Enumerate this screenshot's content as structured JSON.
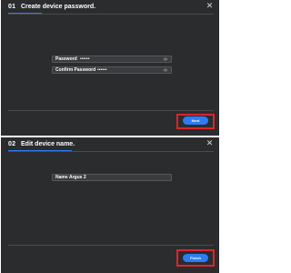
{
  "colors": {
    "dialog_bg": "#2b2c2e",
    "accent": "#2d7cf6",
    "highlight": "#e0242b"
  },
  "dialog1": {
    "step": "01",
    "title": "Create device password.",
    "password_label": "Password",
    "password_value": "••••••",
    "confirm_label": "Confirm Password",
    "confirm_value": "••••••",
    "next_label": "Next",
    "close_icon": "close-icon",
    "visibility_icon": "eye-icon"
  },
  "dialog2": {
    "step": "02",
    "title": "Edit device name.",
    "name_label": "Name",
    "name_value": "Argus 2",
    "finish_label": "Finish",
    "close_icon": "close-icon"
  }
}
